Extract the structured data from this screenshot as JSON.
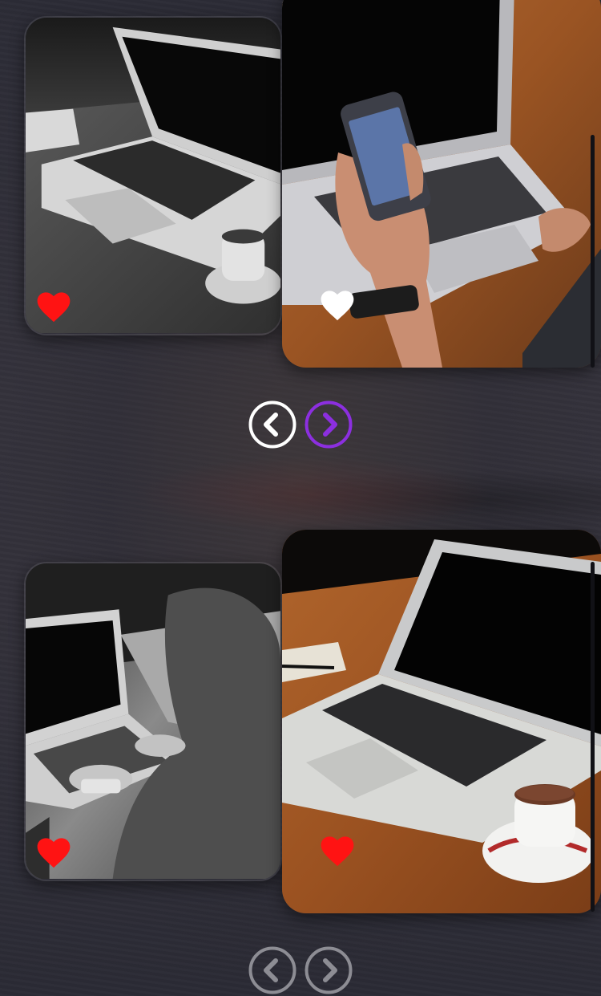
{
  "colors": {
    "heart_active": "#ff1313",
    "heart_inactive": "#ffffff",
    "nav_active": "#8c2fe0",
    "nav_default": "#ffffff",
    "nav_disabled": "#8d8d94",
    "background": "#2f2f39"
  },
  "carousels": [
    {
      "slides": [
        {
          "image": "grayscale-laptop-coffee",
          "favorited": true
        },
        {
          "image": "hand-phone-laptop",
          "favorited": false
        }
      ],
      "controls": {
        "prev": {
          "icon": "chevron-left-icon",
          "state": "default"
        },
        "next": {
          "icon": "chevron-right-icon",
          "state": "active"
        }
      }
    },
    {
      "slides": [
        {
          "image": "grayscale-person-typing",
          "favorited": true
        },
        {
          "image": "laptop-espresso-desk",
          "favorited": true
        }
      ],
      "controls": {
        "prev": {
          "icon": "chevron-left-icon",
          "state": "disabled"
        },
        "next": {
          "icon": "chevron-right-icon",
          "state": "disabled"
        }
      }
    }
  ]
}
